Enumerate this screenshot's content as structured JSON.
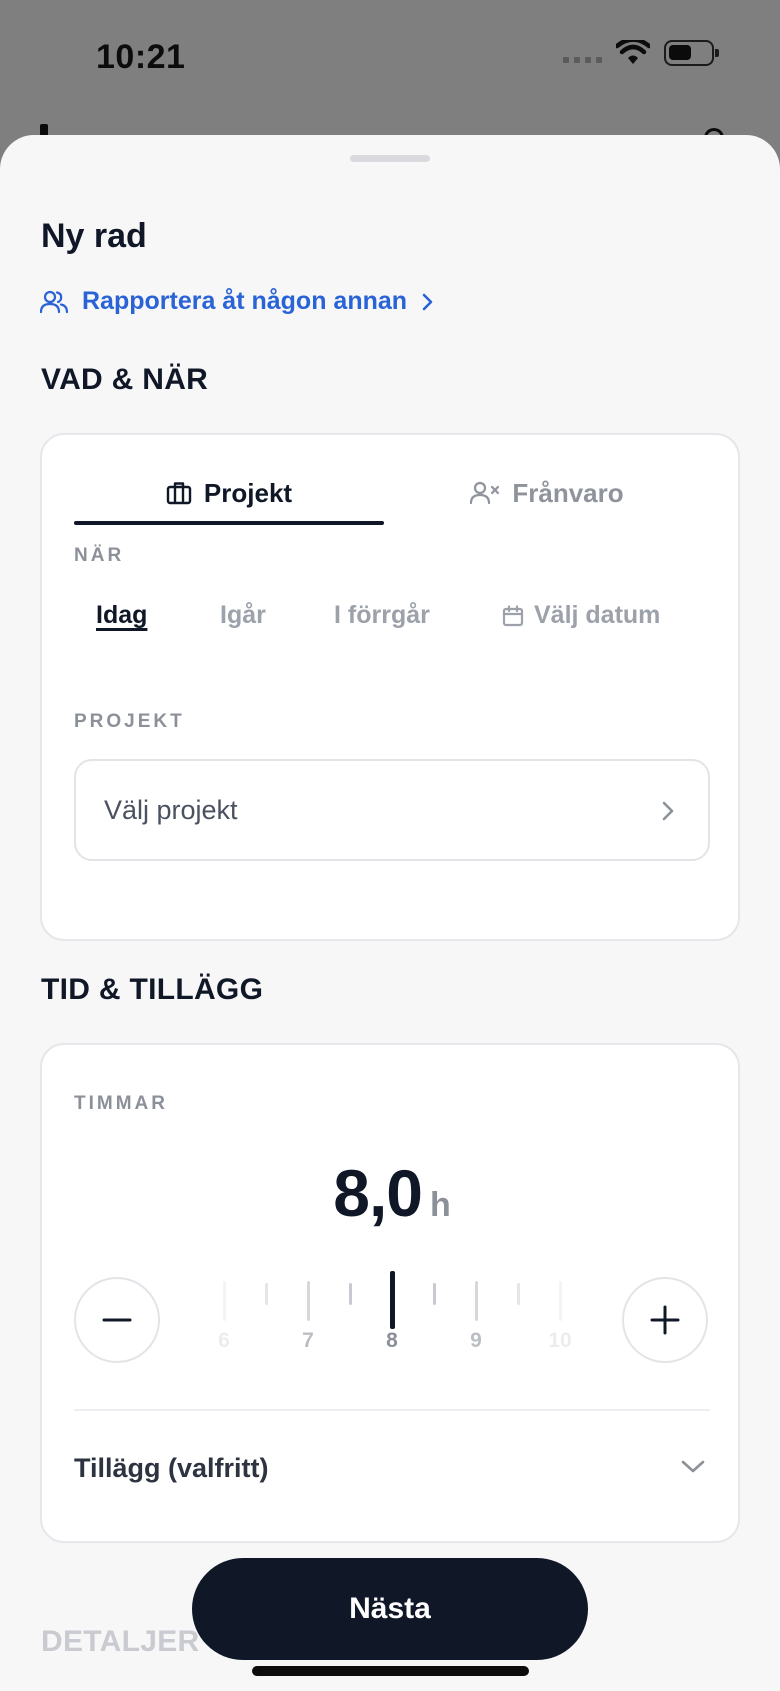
{
  "status_bar": {
    "time": "10:21"
  },
  "sheet": {
    "title": "Ny rad",
    "report_for_other": "Rapportera åt någon annan"
  },
  "sections": {
    "what_when": "VAD & NÄR",
    "time_addons": "TID & TILLÄGG",
    "details": "DETALJER"
  },
  "tabs": [
    {
      "label": "Projekt",
      "icon": "briefcase-icon",
      "selected": true
    },
    {
      "label": "Frånvaro",
      "icon": "person-x-icon",
      "selected": false
    }
  ],
  "when": {
    "label": "NÄR",
    "options": [
      {
        "label": "Idag",
        "selected": true
      },
      {
        "label": "Igår",
        "selected": false
      },
      {
        "label": "I förrgår",
        "selected": false
      },
      {
        "label": "Välj datum",
        "icon": "calendar-icon",
        "selected": false
      }
    ]
  },
  "project": {
    "label": "PROJEKT",
    "placeholder": "Välj projekt"
  },
  "hours": {
    "label": "TIMMAR",
    "value": "8,0",
    "unit": "h",
    "ruler_labels": [
      "6",
      "7",
      "8",
      "9",
      "10"
    ],
    "current": 8
  },
  "addons": {
    "label": "Tillägg (valfritt)"
  },
  "next_button": "Nästa",
  "colors": {
    "primary": "#101828",
    "link": "#2a63d6",
    "muted": "#8b9099",
    "sheet_bg": "#f7f7f8",
    "dim_bg": "#7f7f7f"
  }
}
